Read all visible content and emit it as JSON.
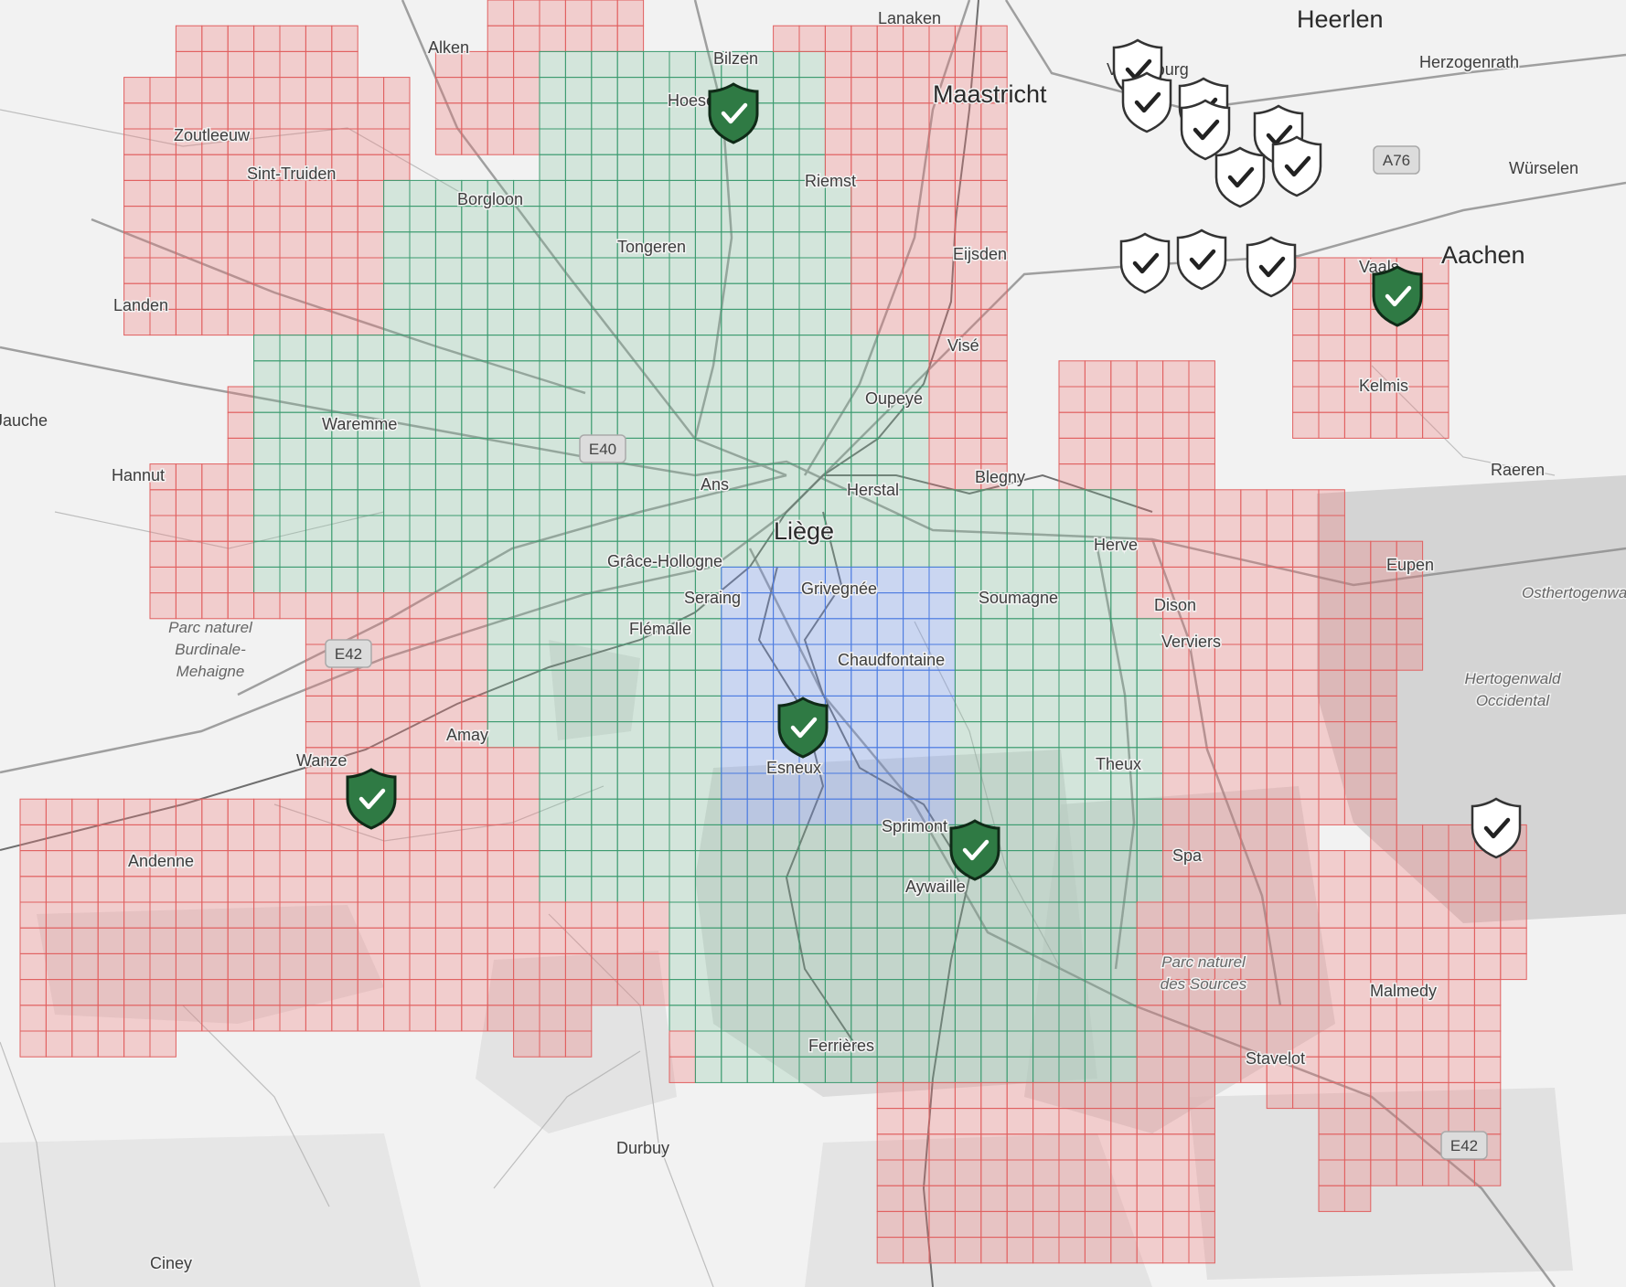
{
  "map": {
    "colors": {
      "land": "#f2f2f2",
      "forest": "#cfcfcf",
      "road": "#8a8a8a",
      "river": "#6f6f6f",
      "cell_red_fill": "rgba(240,120,120,0.30)",
      "cell_red_stroke": "#e06060",
      "cell_green_fill": "rgba(120,190,150,0.25)",
      "cell_green_stroke": "#3b9a6f",
      "cell_blue_fill": "rgba(110,150,240,0.30)",
      "cell_blue_stroke": "#4b7be0",
      "marker_active": "#2f7a44",
      "marker_inactive": "#ffffff"
    },
    "places": [
      {
        "name": "Lanaken"
      },
      {
        "name": "Heerlen"
      },
      {
        "name": "Herzogenrath"
      },
      {
        "name": "Alken"
      },
      {
        "name": "Bilzen"
      },
      {
        "name": "Hoeselt"
      },
      {
        "name": "Maastricht"
      },
      {
        "name": "Valkenburg"
      },
      {
        "name": "Zoutleeuw"
      },
      {
        "name": "Sint-Truiden"
      },
      {
        "name": "Borgloon"
      },
      {
        "name": "Riemst"
      },
      {
        "name": "Würselen"
      },
      {
        "name": "Tongeren"
      },
      {
        "name": "Eijsden"
      },
      {
        "name": "Aachen"
      },
      {
        "name": "Vaals"
      },
      {
        "name": "Landen"
      },
      {
        "name": "Visé"
      },
      {
        "name": "Kelmis"
      },
      {
        "name": "Oupeye"
      },
      {
        "name": "Jauche"
      },
      {
        "name": "Waremme"
      },
      {
        "name": "Raeren"
      },
      {
        "name": "Hannut"
      },
      {
        "name": "Ans"
      },
      {
        "name": "Herstal"
      },
      {
        "name": "Blegny"
      },
      {
        "name": "Liège"
      },
      {
        "name": "Herve"
      },
      {
        "name": "Grâce-Hollogne"
      },
      {
        "name": "Eupen"
      },
      {
        "name": "Grivegnée"
      },
      {
        "name": "Seraing"
      },
      {
        "name": "Soumagne"
      },
      {
        "name": "Dison"
      },
      {
        "name": "Flémalle"
      },
      {
        "name": "Verviers"
      },
      {
        "name": "Chaudfontaine"
      },
      {
        "name": "Amay"
      },
      {
        "name": "Wanze"
      },
      {
        "name": "Esneux"
      },
      {
        "name": "Theux"
      },
      {
        "name": "Sprimont"
      },
      {
        "name": "Andenne"
      },
      {
        "name": "Spa"
      },
      {
        "name": "Aywaille"
      },
      {
        "name": "Malmedy"
      },
      {
        "name": "Ferrières"
      },
      {
        "name": "Stavelot"
      },
      {
        "name": "Durbuy"
      },
      {
        "name": "Ciney"
      }
    ],
    "parks": [
      {
        "lines": [
          "Parc naturel",
          "Burdinale-",
          "Mehaigne"
        ]
      },
      {
        "lines": [
          "Parc naturel",
          "des Sources"
        ]
      },
      {
        "lines": [
          "Hertogenwald",
          "Occidental"
        ]
      },
      {
        "lines": [
          "Osthertogenwald"
        ]
      }
    ],
    "road_shields": [
      {
        "label": "E40"
      },
      {
        "label": "E42"
      },
      {
        "label": "A76"
      },
      {
        "label": "E42"
      }
    ],
    "markers": [
      {
        "state": "active"
      },
      {
        "state": "active"
      },
      {
        "state": "active"
      },
      {
        "state": "active"
      },
      {
        "state": "active"
      },
      {
        "state": "inactive"
      },
      {
        "state": "inactive"
      },
      {
        "state": "inactive"
      },
      {
        "state": "inactive"
      },
      {
        "state": "inactive"
      },
      {
        "state": "inactive"
      },
      {
        "state": "inactive"
      },
      {
        "state": "inactive"
      },
      {
        "state": "inactive"
      },
      {
        "state": "inactive"
      },
      {
        "state": "inactive"
      }
    ]
  }
}
